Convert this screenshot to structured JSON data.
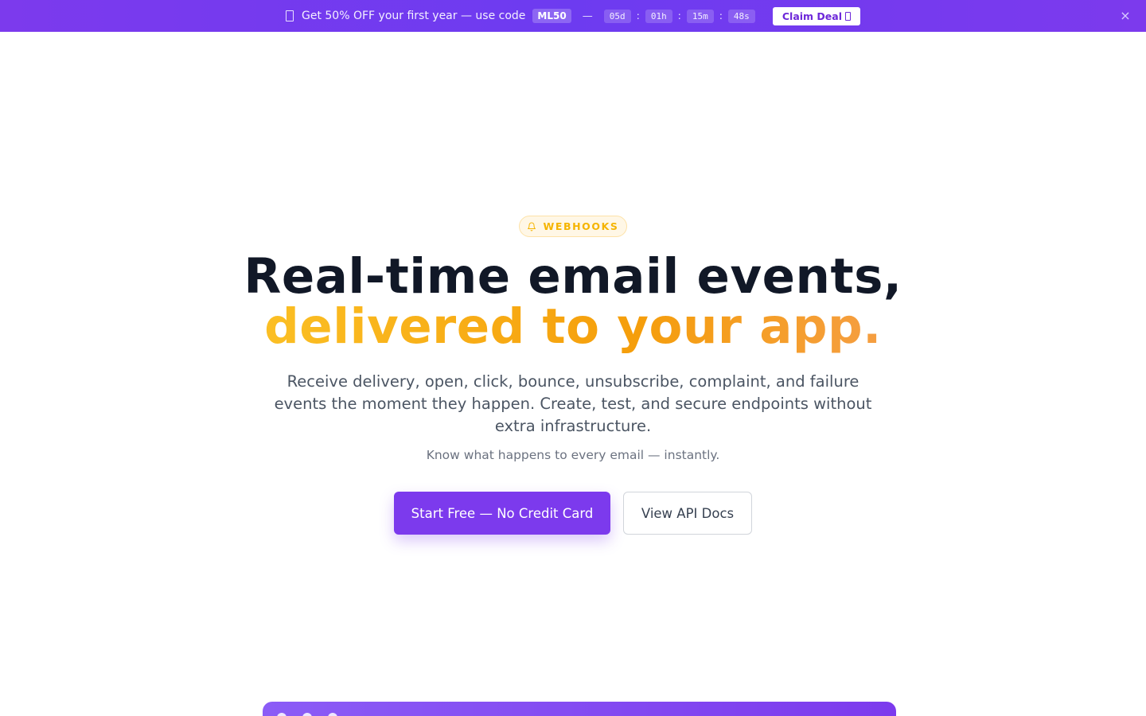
{
  "promo": {
    "text": "Get 50% OFF your first year — use code",
    "code": "ML50",
    "separator": "—",
    "timer": {
      "days": "05d",
      "hours": "01h",
      "minutes": "15m",
      "seconds": "48s"
    },
    "claim_label": "Claim Deal",
    "close_glyph": "×",
    "colors": {
      "banner": "#7c3aed",
      "claim_text": "#6d28d9"
    }
  },
  "hero": {
    "badge": "WEBHOOKS",
    "title_line1": "Real-time email events,",
    "title_line2": "delivered to your app.",
    "subtitle": "Receive delivery, open, click, bounce, unsubscribe, complaint, and failure events the moment they happen. Create, test, and secure endpoints without extra infrastructure.",
    "tagline": "Know what happens to every email — instantly.",
    "primary_cta": "Start Free — No Credit Card",
    "secondary_cta": "View API Docs",
    "colors": {
      "accent": "#7c3aed",
      "highlight": "#f59e0b",
      "badge": "#f5b400"
    }
  },
  "icons": {
    "promo": "gift-icon",
    "claim": "arrow-icon",
    "close": "close-icon",
    "badge": "bell-icon"
  }
}
